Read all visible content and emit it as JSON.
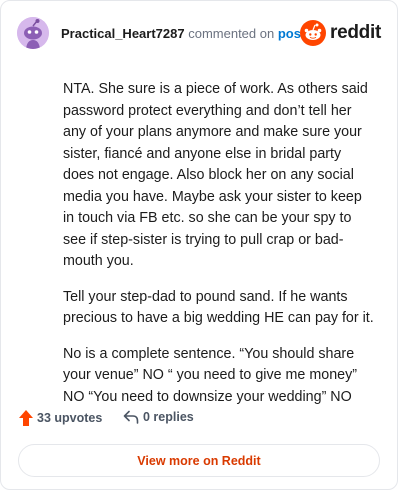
{
  "header": {
    "username": "Practical_Heart7287",
    "action": "commented on",
    "post_link": "post",
    "brand": "reddit"
  },
  "comment": {
    "paragraphs": [
      "NTA. She sure is a piece of work. As others said password protect everything and don’t tell her any of your plans anymore and make sure your sister, fiancé and anyone else in bridal party does not engage. Also block her on any social media you have. Maybe ask your sister to keep in touch via FB etc. so she can be your spy to see if step-sister is trying to pull crap or bad-mouth you.",
      "Tell your step-dad to pound sand. If he wants precious to have a big wedding HE can pay for it.",
      "No is a complete sentence. “You should share your venue” NO “ you need to give me money” NO “You need to downsize your wedding” NO"
    ]
  },
  "footer": {
    "upvotes": "33 upvotes",
    "replies": "0 replies",
    "view_more": "View more on Reddit"
  },
  "colors": {
    "accent": "#ff4500",
    "link": "#0079d3",
    "view_more_text": "#d93a00"
  },
  "icons": {
    "avatar": "snoo-avatar-icon",
    "logo": "reddit-logo-icon",
    "upvote": "upvote-arrow-icon",
    "reply": "reply-arrow-icon"
  }
}
